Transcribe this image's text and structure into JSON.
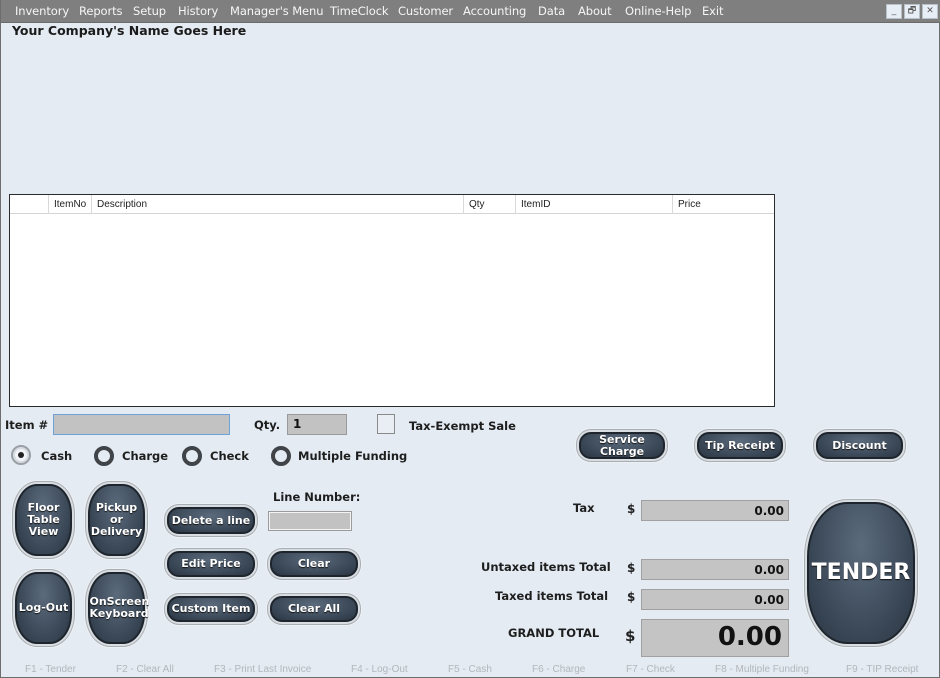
{
  "menu": [
    "Inventory",
    "Reports",
    "Setup",
    "History",
    "Manager's Menu",
    "TimeClock",
    "Customer",
    "Accounting",
    "Data",
    "About",
    "Online-Help",
    "Exit"
  ],
  "window_controls": {
    "minimize": "_",
    "restore": "🗗",
    "close": "✕"
  },
  "company_name": "Your Company's Name Goes Here",
  "grid": {
    "columns": [
      "",
      "ItemNo",
      "Description",
      "Qty",
      "ItemID",
      "Price"
    ],
    "rows": []
  },
  "item_entry": {
    "item_label": "Item #",
    "item_value": "",
    "qty_label": "Qty.",
    "qty_value": "1",
    "tax_exempt_label": "Tax-Exempt Sale",
    "tax_exempt_checked": false
  },
  "payment_methods": [
    {
      "label": "Cash",
      "selected": true
    },
    {
      "label": "Charge",
      "selected": false
    },
    {
      "label": "Check",
      "selected": false
    },
    {
      "label": "Multiple Funding",
      "selected": false
    }
  ],
  "buttons": {
    "service_charge": "Service Charge",
    "tip_receipt": "Tip Receipt",
    "discount": "Discount",
    "floor_table_view": "Floor Table View",
    "pickup_delivery": "Pickup or Delivery",
    "log_out": "Log-Out",
    "onscreen_keyboard": "OnScreen Keyboard",
    "delete_line": "Delete a line",
    "edit_price": "Edit Price",
    "custom_item": "Custom Item",
    "clear": "Clear",
    "clear_all": "Clear All",
    "tender": "TENDER"
  },
  "line_number": {
    "label": "Line Number:",
    "value": ""
  },
  "totals": {
    "currency": "$",
    "tax_label": "Tax",
    "tax": "0.00",
    "untaxed_label": "Untaxed items Total",
    "untaxed": "0.00",
    "taxed_label": "Taxed items Total",
    "taxed": "0.00",
    "grand_label": "GRAND TOTAL",
    "grand": "0.00"
  },
  "function_keys": [
    "F1 - Tender",
    "F2 - Clear All",
    "F3 - Print Last Invoice",
    "F4 - Log-Out",
    "F5 - Cash",
    "F6 - Charge",
    "F7 - Check",
    "F8 - Multiple Funding",
    "F9 - TIP Receipt"
  ]
}
